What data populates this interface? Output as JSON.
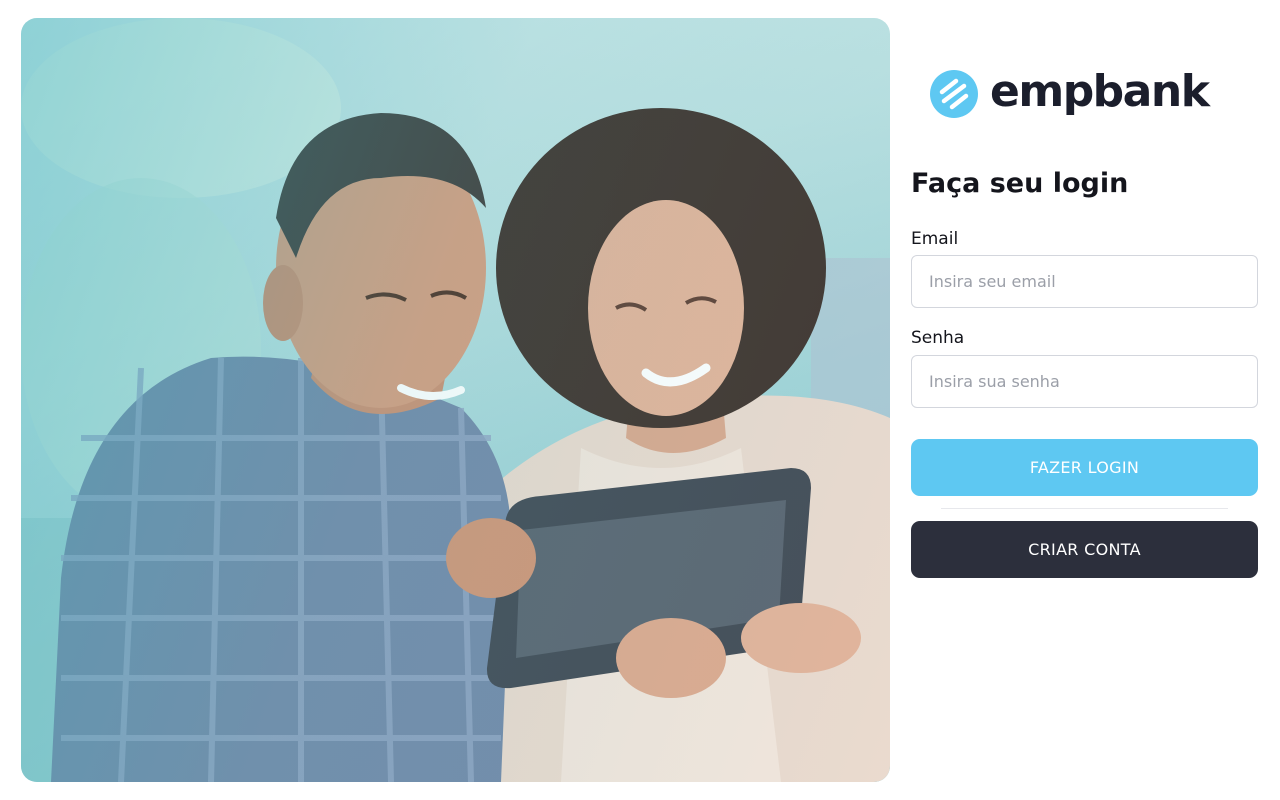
{
  "brand": {
    "name": "empbank",
    "accent_color": "#5ec8f2",
    "dark_color": "#2c2f3c"
  },
  "hero": {
    "icon": "couple-with-tablet-photo"
  },
  "login": {
    "title": "Faça seu login",
    "email_label": "Email",
    "email_placeholder": "Insira seu email",
    "email_value": "",
    "password_label": "Senha",
    "password_placeholder": "Insira sua senha",
    "password_value": "",
    "login_button": "FAZER LOGIN",
    "create_account_button": "CRIAR CONTA"
  }
}
